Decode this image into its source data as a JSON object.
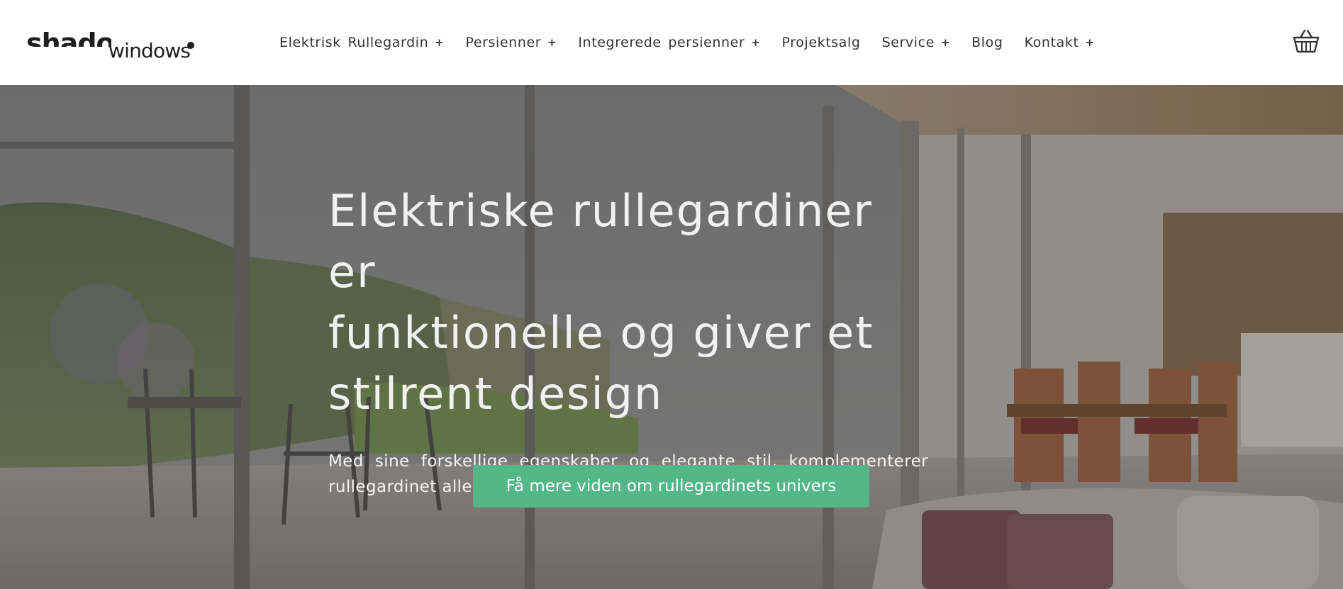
{
  "brand": {
    "logo_bold": "shadow",
    "logo_light": "windows"
  },
  "nav": {
    "items": [
      {
        "label": "Elektrisk Rullegardin",
        "has_submenu": true
      },
      {
        "label": "Persienner",
        "has_submenu": true
      },
      {
        "label": "Integrerede persienner",
        "has_submenu": true
      },
      {
        "label": "Projektsalg",
        "has_submenu": false
      },
      {
        "label": "Service",
        "has_submenu": true
      },
      {
        "label": "Blog",
        "has_submenu": false
      },
      {
        "label": "Kontakt",
        "has_submenu": true
      }
    ],
    "submenu_icon": "plus-icon",
    "cart_icon": "basket-icon"
  },
  "hero": {
    "title_lines": [
      "Elektriske rullegardiner er",
      "funktionelle og giver et",
      "stilrent design"
    ],
    "subtitle": "Med sine forskellige egenskaber og elegante stil, komplementerer rullegardinet alle rum, på arbejdspladsen og i hjemmet.",
    "cta_label": "Få mere viden om rullegardinets univers"
  },
  "colors": {
    "cta_background": "#54b786",
    "nav_text": "#333333",
    "hero_text": "#f1f1f1"
  }
}
